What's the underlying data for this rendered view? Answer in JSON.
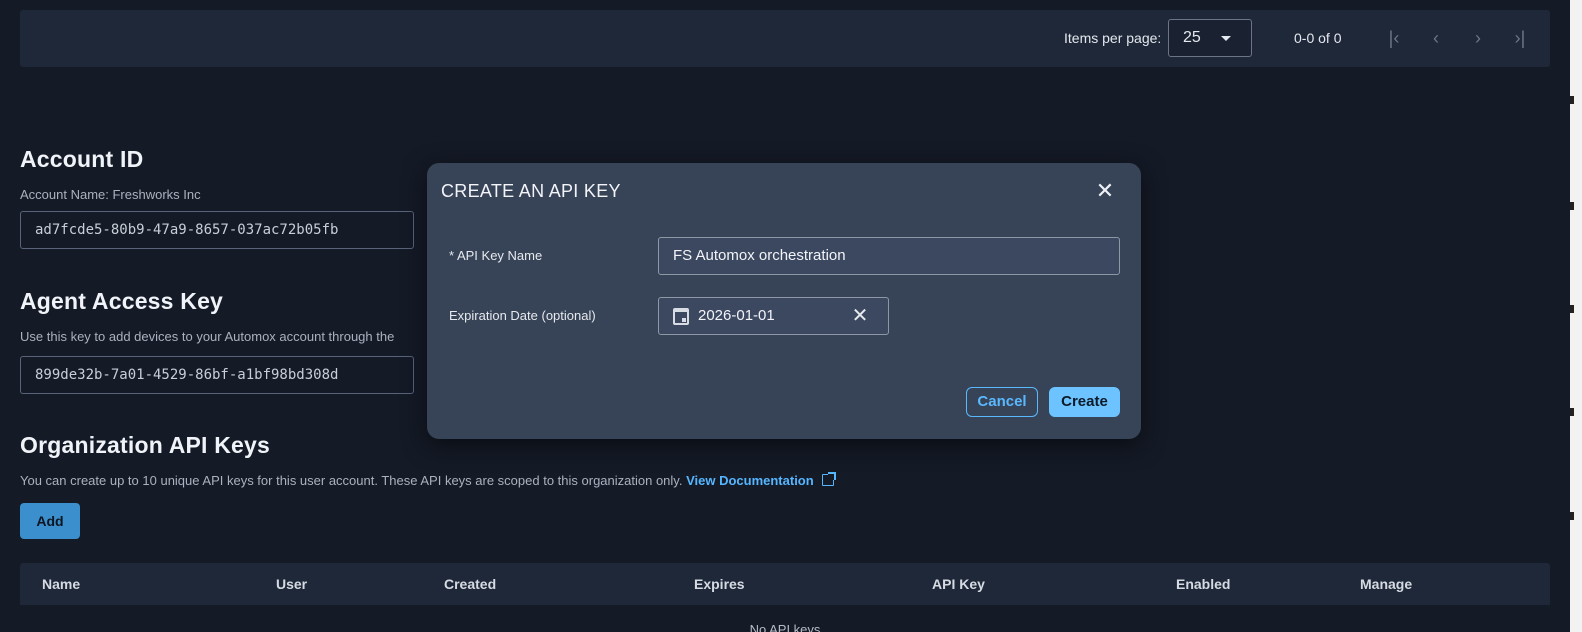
{
  "pagination": {
    "items_per_page_label": "Items per page:",
    "items_per_page_value": "25",
    "range_text": "0-0 of 0",
    "first_icon": "first-page-icon",
    "prev_icon": "chevron-left-icon",
    "next_icon": "chevron-right-icon",
    "last_icon": "last-page-icon"
  },
  "account": {
    "heading": "Account ID",
    "name_label": "Account Name: Freshworks Inc",
    "id_value": "ad7fcde5-80b9-47a9-8657-037ac72b05fb"
  },
  "agent_key": {
    "heading": "Agent Access Key",
    "description": "Use this key to add devices to your Automox account through the",
    "key_value": "899de32b-7a01-4529-86bf-a1bf98bd308d"
  },
  "org_api_keys": {
    "heading": "Organization API Keys",
    "description": "You can create up to 10 unique API keys for this user account. These API keys are scoped to this organization only.",
    "doc_link": "View Documentation",
    "add_button": "Add",
    "columns": [
      "Name",
      "User",
      "Created",
      "Expires",
      "API Key",
      "Enabled",
      "Manage"
    ],
    "empty_text": "No API keys"
  },
  "modal": {
    "title": "CREATE AN API KEY",
    "name_label": "* API Key Name",
    "name_value": "FS Automox orchestration",
    "expiration_label": "Expiration Date (optional)",
    "expiration_value": "2026-01-01",
    "cancel_button": "Cancel",
    "create_button": "Create"
  },
  "colors": {
    "background": "#141a26",
    "panel": "#1f2838",
    "modal": "#374357",
    "accent": "#6cc3ff",
    "link": "#56b6ff"
  }
}
